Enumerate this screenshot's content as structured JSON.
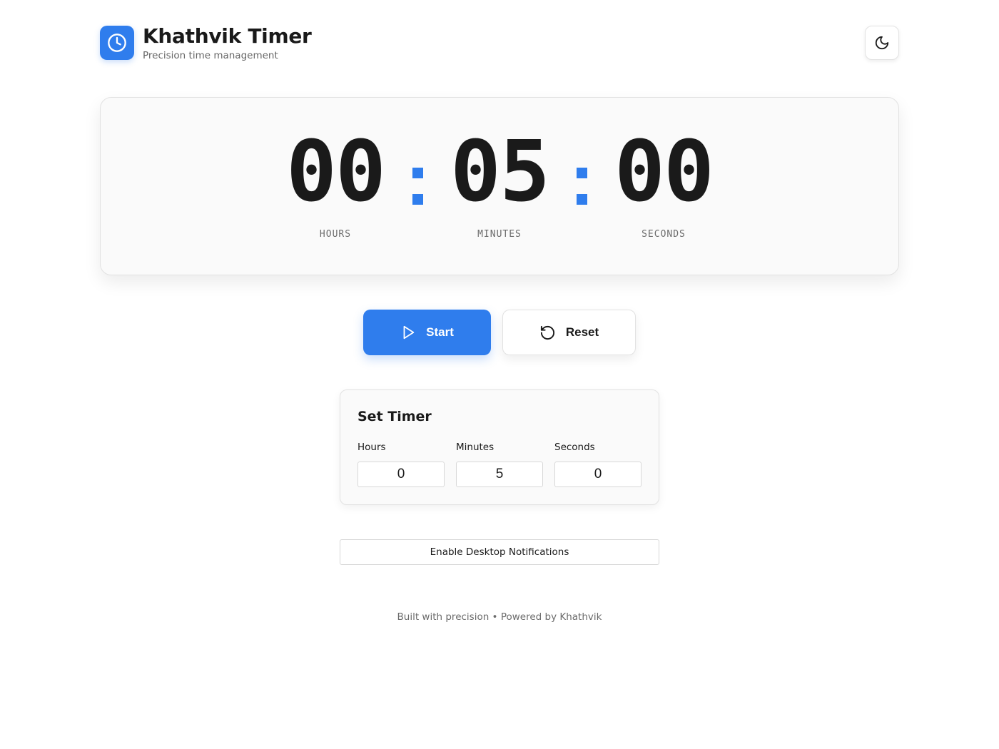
{
  "header": {
    "title": "Khathvik Timer",
    "subtitle": "Precision time management",
    "logo_icon": "clock-icon",
    "theme_toggle_icon": "moon-icon"
  },
  "display": {
    "hours": "00",
    "minutes": "05",
    "seconds": "00",
    "hours_label": "HOURS",
    "minutes_label": "MINUTES",
    "seconds_label": "SECONDS"
  },
  "controls": {
    "start_label": "Start",
    "start_icon": "play-icon",
    "reset_label": "Reset",
    "reset_icon": "rotate-ccw-icon"
  },
  "set_timer": {
    "title": "Set Timer",
    "hours_label": "Hours",
    "minutes_label": "Minutes",
    "seconds_label": "Seconds",
    "hours_value": "0",
    "minutes_value": "5",
    "seconds_value": "0"
  },
  "notifications": {
    "button_label": "Enable Desktop Notifications"
  },
  "footer": {
    "text": "Built with precision • Powered by Khathvik"
  },
  "colors": {
    "accent": "#2f7ded",
    "text": "#1a1a1a",
    "muted": "#6b6b6b",
    "card_bg": "#fafafa"
  }
}
